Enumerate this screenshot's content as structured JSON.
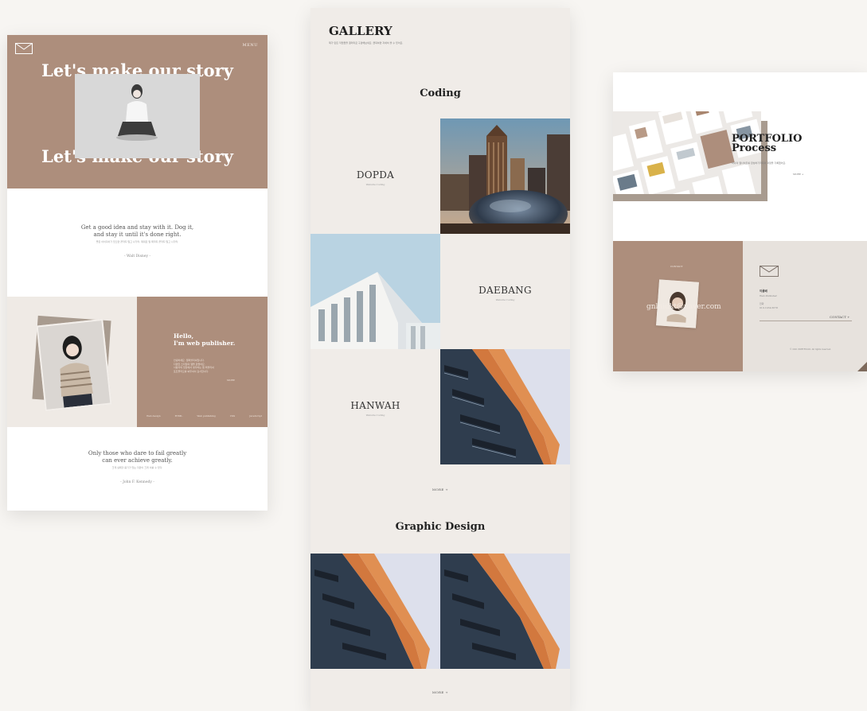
{
  "left": {
    "menu": "MENU",
    "hero_title_top": "Let's make our story",
    "hero_title_bottom": "Let's make our story",
    "quote1": "Get a good idea and stay with it. Dog it, and stay it until it's done right.",
    "quote1_line1": "Get a good idea and stay with it. Dog it,",
    "quote1_line2": "and stay it until it's done right.",
    "quote1_translation": "좋은 아이디어가 있으면 끝까지 밀고 나가라. 제대로 될 때까지 끝까지 밀고 나가라.",
    "quote1_author": "- Walt Disney -",
    "hello_line1": "Hello,",
    "hello_line2": "I'm web publisher.",
    "hello_small": [
      "안녕하세요. 웹퍼블리셔입니다.",
      "다양한 스타일의 웹을 만들어요.",
      "사용자의 입장에서 생각하는 웹 퍼블리셔",
      "포트폴리오를 봐주셔서 감사합니다."
    ],
    "hello_more": "MORE",
    "stats": [
      "Web design",
      "HTML",
      "Web publishing",
      "CSS",
      "JavaScript"
    ],
    "quote2_line1": "Only those who dare to fail greatly",
    "quote2_line2": "can ever achieve greatly.",
    "quote2_translation": "크게 실패할 용기가 있는 자만이 크게 이룰 수 있다.",
    "quote2_author": "- John F. Kennedy -"
  },
  "middle": {
    "logo": "GALLERY",
    "subtitle": "제가 만든 작업들을 갤러리로 구경해보세요. 클릭하면 자세히 볼 수 있어요.",
    "section1": "Coding",
    "projects": [
      {
        "title": "DOPDA",
        "sub": "Website Coding"
      },
      {
        "title": "DAEBANG",
        "sub": "Website Coding"
      },
      {
        "title": "HANWAH",
        "sub": "Website Coding"
      }
    ],
    "more1": "MORE +",
    "section2": "Graphic Design",
    "more2": "MORE +"
  },
  "right": {
    "portfolio_line1": "PORTFOLIO",
    "portfolio_line2": "Process",
    "portfolio_sub": "하나의 웹사이트를 완성하기까지의 과정을 기록했어요.",
    "portfolio_more": "MORE +",
    "contact_label": "CONTACT",
    "email": "gnlnidkt@naver.com",
    "name": "이름배",
    "role": "Web Publisher",
    "line1": "전화",
    "line2": "010-1234-5678",
    "contact_button": "CONTACT +",
    "copyright": "© 2021 PORTFOLIO. All rights reserved."
  },
  "colors": {
    "accent_brown": "#ad8e7c",
    "beige": "#efeae5",
    "background": "#f7f5f2"
  }
}
